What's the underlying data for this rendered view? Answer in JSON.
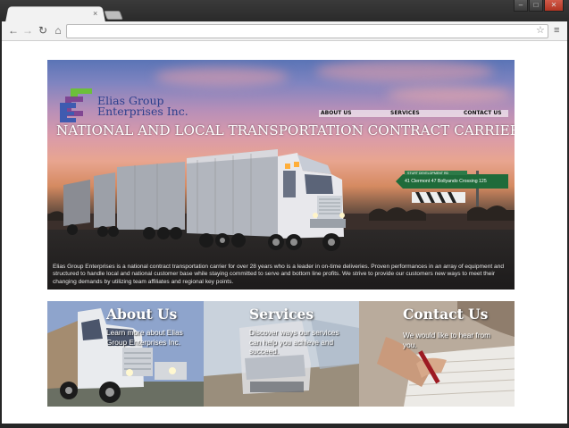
{
  "browser": {
    "tab_close": "×",
    "url": ""
  },
  "site": {
    "logo_line1": "Elias Group",
    "logo_line2": "Enterprises Inc.",
    "nav": [
      "ABOUT US",
      "SERVICES",
      "CONTACT US"
    ],
    "headline": "NATIONAL AND LOCAL TRANSPORTATION CONTRACT CARRIER",
    "description": "Elias Group Enterprises is a national contract transportation carrier for over 28 years who is a leader in on-time deliveries. Proven performances in an array of equipment and structured to handle local and national customer base while staying committed to serve and bottom line profits. We strive to provide our customers new ways to meet their changing demands by utilizing team affiliates and regional key points.",
    "road_sign_line1": "STURT DEVELOPMENT RD",
    "road_sign_line2": "41 Clermont  47 Bollyando Crossing 125"
  },
  "panels": [
    {
      "title": "About Us",
      "text": "Learn more about Elias Group Enterprises Inc."
    },
    {
      "title": "Services",
      "text": "Discover ways our services can help you achieve and succeed."
    },
    {
      "title": "Contact Us",
      "text": "We would like to hear from you."
    }
  ],
  "colors": {
    "logo_green": "#6cbf3a",
    "logo_purple": "#7a3e8e",
    "logo_blue": "#3f5bb0",
    "sign_green": "#1f6b3a"
  }
}
